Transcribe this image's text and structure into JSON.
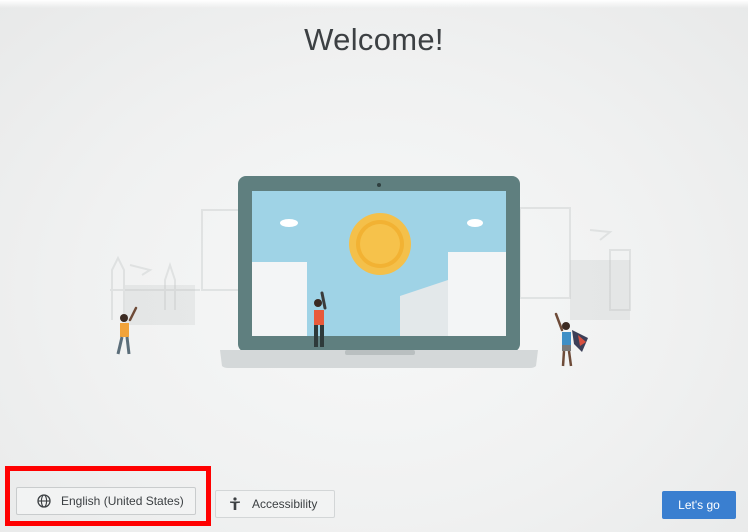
{
  "screen": {
    "title": "Welcome!"
  },
  "buttons": {
    "language_label": "English (United States)",
    "accessibility_label": "Accessibility",
    "lets_go_label": "Let's go"
  },
  "icons": {
    "language": "globe-icon",
    "accessibility": "accessibility-person-icon"
  },
  "colors": {
    "primary_button": "#3a7fd0",
    "highlight": "#ff0000",
    "laptop_frame": "#5f7f7f",
    "laptop_screen": "#9fd3e6",
    "sun": "#f2b233"
  }
}
